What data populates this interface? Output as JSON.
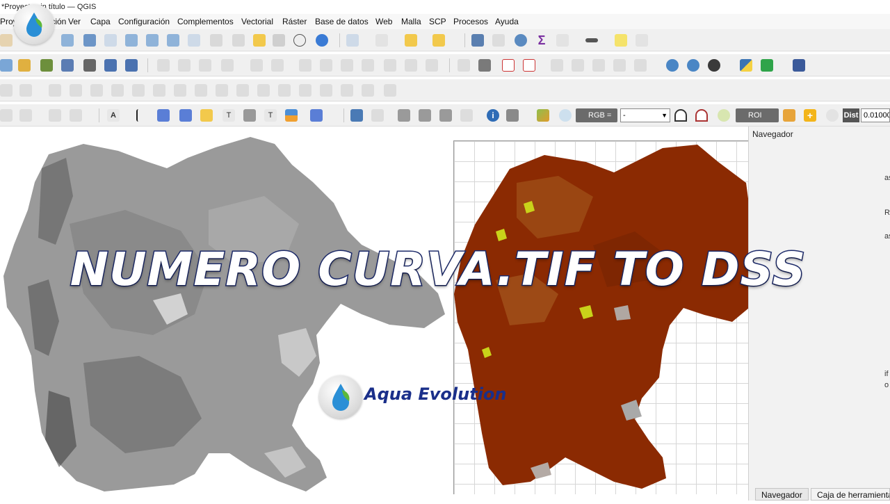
{
  "window": {
    "title": "*Proyecto sin título — QGIS"
  },
  "menu": [
    "Proyecto",
    "Edición",
    "Ver",
    "Capa",
    "Configuración",
    "Complementos",
    "Vectorial",
    "Ráster",
    "Base de datos",
    "Web",
    "Malla",
    "SCP",
    "Procesos",
    "Ayuda"
  ],
  "scp_toolbar": {
    "rgb_label": "RGB =",
    "rgb_value": "-",
    "roi_label": "ROI",
    "dist_label": "Dist",
    "dist_value": "0.01000"
  },
  "panel": {
    "navigator_header": "Navegador",
    "side_fragments": [
      "as",
      "R",
      "as",
      "if",
      "o"
    ]
  },
  "bottom_tabs": [
    "Navegador",
    "Caja de herramientas"
  ],
  "overlay": {
    "headline": "NUMERO CURVA.TIF  TO  DSS",
    "brand": "Aqua Evolution"
  },
  "colors": {
    "brand_blue": "#1a2f8a",
    "headline_stroke": "#1c2a6b",
    "raster_brown": "#8b2a02",
    "raster_gray": "#9a9a9a"
  },
  "icons": [
    "pan-icon",
    "zoom-in-icon",
    "zoom-out-icon",
    "identify-icon",
    "python-icon",
    "help-icon",
    "measure-icon",
    "gear-icon",
    "sum-icon"
  ]
}
